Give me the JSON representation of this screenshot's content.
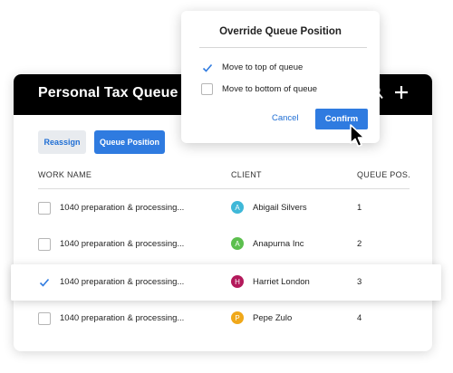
{
  "header": {
    "title": "Personal Tax Queue",
    "icons": [
      "search-icon",
      "plus-icon"
    ]
  },
  "toolbar": {
    "reassign_label": "Reassign",
    "queue_position_label": "Queue Position"
  },
  "table": {
    "columns": [
      "WORK NAME",
      "CLIENT",
      "QUEUE POS."
    ],
    "rows": [
      {
        "work_name": "1040 preparation & processing...",
        "client": "Abigail Silvers",
        "initial": "A",
        "avatar_color": "#3fb8d8",
        "pos": "1",
        "checked": false
      },
      {
        "work_name": "1040 preparation & processing...",
        "client": "Anapurna Inc",
        "initial": "A",
        "avatar_color": "#5cbf4e",
        "pos": "2",
        "checked": false
      },
      {
        "work_name": "1040 preparation & processing...",
        "client": "Harriet London",
        "initial": "H",
        "avatar_color": "#b3195b",
        "pos": "3",
        "checked": true
      },
      {
        "work_name": "1040 preparation & processing...",
        "client": "Pepe Zulo",
        "initial": "P",
        "avatar_color": "#f0a81a",
        "pos": "4",
        "checked": false
      }
    ]
  },
  "popover": {
    "title": "Override Queue Position",
    "options": [
      {
        "label": "Move to top of queue",
        "checked": true
      },
      {
        "label": "Move to bottom of queue",
        "checked": false
      }
    ],
    "cancel_label": "Cancel",
    "confirm_label": "Confirm"
  },
  "colors": {
    "accent": "#2f7be0",
    "link": "#1f6ed4",
    "header_bg": "#000000"
  }
}
